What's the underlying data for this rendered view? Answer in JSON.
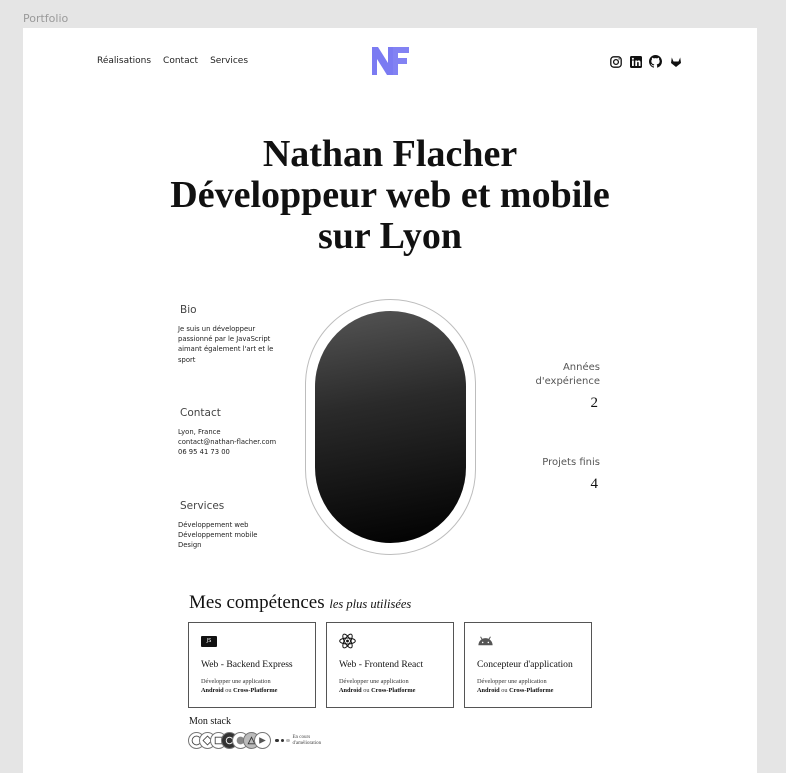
{
  "frame_label": "Portfolio",
  "nav": {
    "items": [
      "Réalisations",
      "Contact",
      "Services"
    ]
  },
  "logo": {
    "text": "NF",
    "color": "#7b7bf2"
  },
  "socials": [
    "instagram-icon",
    "linkedin-icon",
    "github-icon",
    "gitlab-icon"
  ],
  "hero": {
    "line1": "Nathan Flacher",
    "line2": "Développeur web et mobile",
    "line3": "sur Lyon"
  },
  "bio": {
    "title": "Bio",
    "text": "Je suis un développeur passionné par le JavaScript aimant également l'art et le sport"
  },
  "contact": {
    "title": "Contact",
    "lines": [
      "Lyon, France",
      "contact@nathan-flacher.com",
      "06 95 41 73 00"
    ]
  },
  "services": {
    "title": "Services",
    "lines": [
      "Développement web",
      "Développement mobile",
      "Design"
    ]
  },
  "stats": [
    {
      "label_line1": "Années",
      "label_line2": "d'expérience",
      "value": "2"
    },
    {
      "label": "Projets finis",
      "value": "4"
    }
  ],
  "skills": {
    "title": "Mes compétences",
    "subtitle": "les plus utilisées",
    "cards": [
      {
        "icon": "js-icon",
        "badge": "JS",
        "title": "Web - Backend Express",
        "desc": "Développer une application",
        "desc_strong1": "Android",
        "desc_mid": "ou",
        "desc_strong2": "Cross-Platforme"
      },
      {
        "icon": "react-icon",
        "title": "Web - Frontend React",
        "desc": "Développer une application",
        "desc_strong1": "Android",
        "desc_mid": "ou",
        "desc_strong2": "Cross-Platforme"
      },
      {
        "icon": "android-icon",
        "title": "Concepteur d'application",
        "desc": "Développer une application",
        "desc_strong1": "Android",
        "desc_mid": "ou",
        "desc_strong2": "Cross-Platforme"
      }
    ]
  },
  "stack": {
    "title": "Mon stack",
    "note_line1": "En cours",
    "note_line2": "d'amélioration"
  }
}
